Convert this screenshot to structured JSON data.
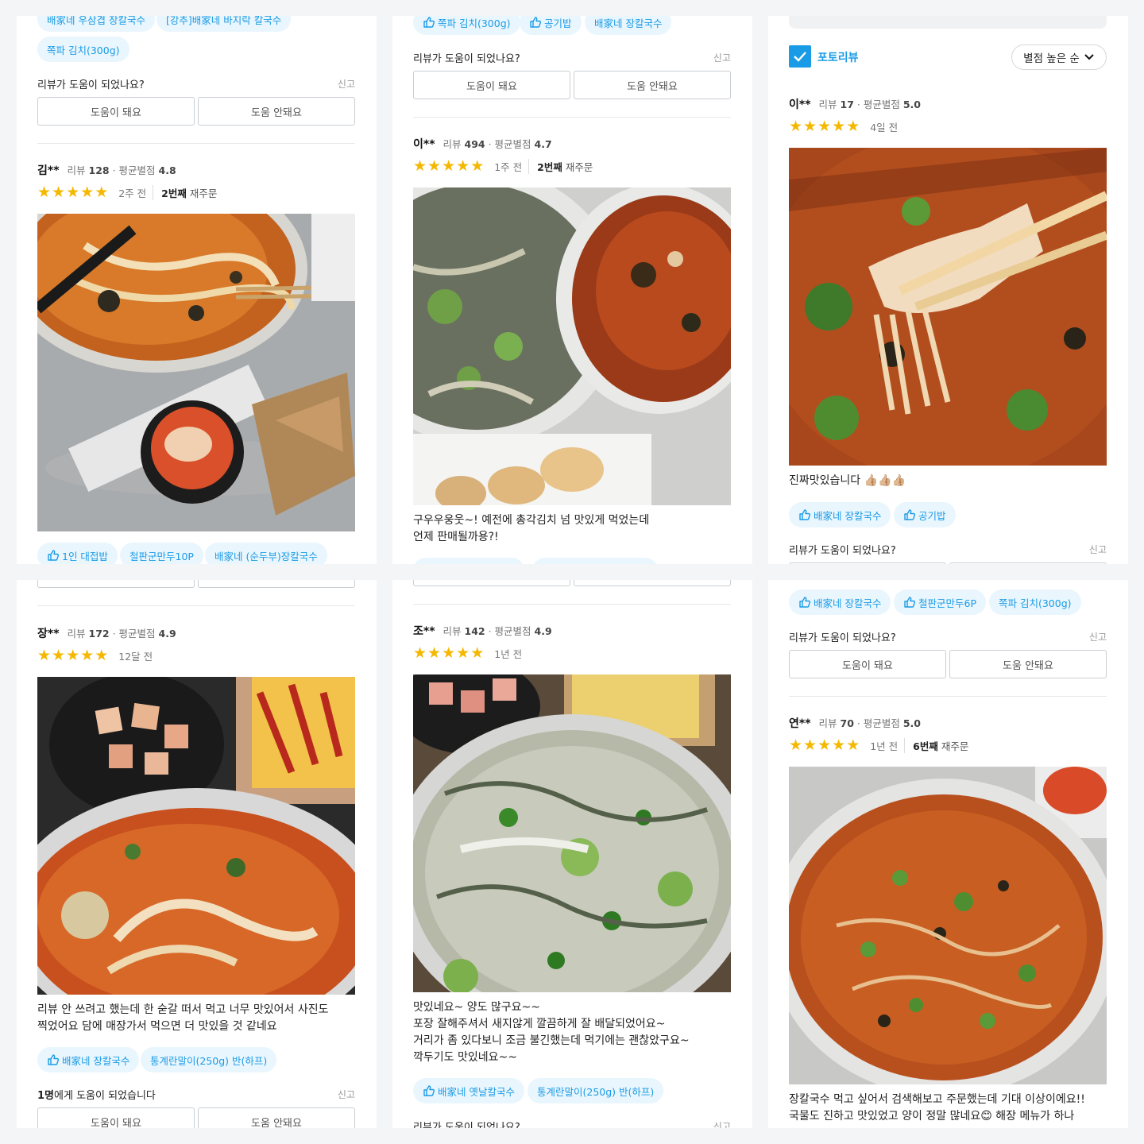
{
  "common": {
    "help_question": "리뷰가 도움이 되었나요?",
    "report": "신고",
    "helpful": "도움이 돼요",
    "not_helpful": "도움 안돼요",
    "star_glyph": "★",
    "accent_color": "#1a9be6"
  },
  "p1": {
    "top_chips": [
      "배家네 우삼겹 장칼국수",
      "[강추]배家네 바지락 칼국수"
    ],
    "chip_kimchi": "쪽파 김치(300g)",
    "review": {
      "name": "김**",
      "review_count_label": "리뷰",
      "review_count": "128",
      "avg_label": "· 평균별점",
      "avg": "4.8",
      "rating": 5,
      "date": "2주 전",
      "reorder_num": "2번째",
      "reorder_label": "재주문"
    },
    "chips": [
      "1인 대접밥",
      "철판군만두10P",
      "배家네 (순두부)장칼국수"
    ]
  },
  "p2": {
    "top_chips": [
      "쪽파 김치(300g)",
      "공기밥",
      "배家네 장칼국수"
    ],
    "review": {
      "name": "이**",
      "review_count_label": "리뷰",
      "review_count": "494",
      "avg_label": "· 평균별점",
      "avg": "4.7",
      "rating": 5,
      "date": "1주 전",
      "reorder_num": "2번째",
      "reorder_label": "재주문",
      "text1": "구우우웅웃~! 예전에 총각김치 넘 맛있게 먹었는데",
      "text2": "언제 판매될까용?!"
    }
  },
  "p3": {
    "photo_review_label": "포토리뷰",
    "sort_label": "별점 높은 순",
    "review": {
      "name": "이**",
      "review_count_label": "리뷰",
      "review_count": "17",
      "avg_label": "· 평균별점",
      "avg": "5.0",
      "rating": 5,
      "date": "4일 전",
      "text": "진짜맛있습니다 👍🏼👍🏼👍🏼"
    },
    "chips": [
      "배家네 장칼국수",
      "공기밥"
    ]
  },
  "p4": {
    "review": {
      "name": "장**",
      "review_count_label": "리뷰",
      "review_count": "172",
      "avg_label": "· 평균별점",
      "avg": "4.9",
      "rating": 5,
      "date": "12달 전",
      "text1": "리뷰 안 쓰려고 했는데 한 숟갈 떠서 먹고 너무 맛있어서 사진도",
      "text2": "찍었어요 담에 매장가서 먹으면 더 맛있을 것 같네요"
    },
    "chips": [
      "배家네 장칼국수",
      "통계란말이(250g) 반(하프)"
    ],
    "helped_count": "1명",
    "helped_suffix": "에게 도움이 되었습니다"
  },
  "p5": {
    "review": {
      "name": "조**",
      "review_count_label": "리뷰",
      "review_count": "142",
      "avg_label": "· 평균별점",
      "avg": "4.9",
      "rating": 5,
      "date": "1년 전",
      "text1": "맛있네요~ 양도 많구요~~",
      "text2": "포장 잘해주셔서 새지않게 깔끔하게 잘 배달되었어요~",
      "text3": "거리가 좀 있다보니 조금 불긴했는데 먹기에는 괜찮았구요~",
      "text4": "깍두기도 맛있네요~~"
    },
    "chips": [
      "배家네 옛날칼국수",
      "통계란말이(250g) 반(하프)"
    ]
  },
  "p6": {
    "top_chips": [
      "배家네 장칼국수",
      "철판군만두6P",
      "쪽파 김치(300g)"
    ],
    "review": {
      "name": "연**",
      "review_count_label": "리뷰",
      "review_count": "70",
      "avg_label": "· 평균별점",
      "avg": "5.0",
      "rating": 5,
      "date": "1년 전",
      "reorder_num": "6번째",
      "reorder_label": "재주문",
      "text1": "장칼국수 먹고 싶어서 검색해보고 주문했는데 기대 이상이에요!!",
      "text2": "국물도 진하고 맛있었고 양이 정말 많네요😊 해장 메뉴가 하나"
    }
  }
}
